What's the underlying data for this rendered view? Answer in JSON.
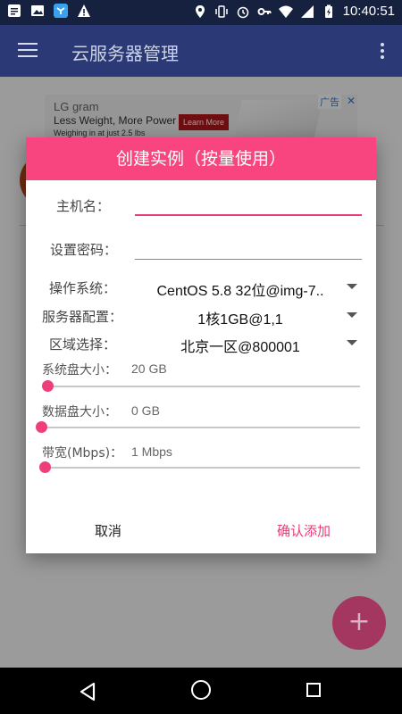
{
  "statusbar": {
    "time": "10:40:51"
  },
  "appbar": {
    "title": "云服务器管理"
  },
  "ad": {
    "brand": "LG gram",
    "headline": "Less Weight, More Power",
    "subline": "Weighing in at just 2.5 lbs",
    "cta": "Learn More",
    "tag": "广告"
  },
  "dialog": {
    "title": "创建实例（按量使用）",
    "hostname": {
      "label": "主机名：",
      "value": ""
    },
    "password": {
      "label": "设置密码：",
      "value": ""
    },
    "os": {
      "label": "操作系统：",
      "value": "CentOS 5.8 32位@img-7.."
    },
    "config": {
      "label": "服务器配置：",
      "value": "1核1GB@1,1"
    },
    "zone": {
      "label": "区域选择：",
      "value": "北京一区@800001"
    },
    "system_disk": {
      "label": "系统盘大小：",
      "value_text": "20 GB",
      "level": 0
    },
    "data_disk": {
      "label": "数据盘大小：",
      "value_text": "0 GB",
      "level": 0
    },
    "bandwidth": {
      "label": "带宽(Mbps)：",
      "value_text": "1 Mbps",
      "level": 0
    },
    "cancel_label": "取消",
    "confirm_label": "确认添加"
  },
  "fab": {
    "icon": "plus-icon",
    "glyph": "+"
  },
  "colors": {
    "accent": "#f8457f",
    "appbar": "#2b3a77",
    "statusbar": "#16213f"
  }
}
